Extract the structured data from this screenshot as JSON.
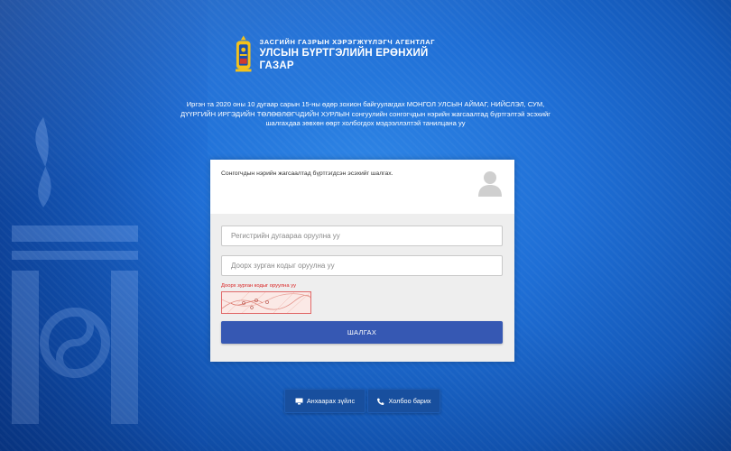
{
  "header": {
    "agency_line1": "ЗАСГИЙН ГАЗРЫН ХЭРЭГЖҮҮЛЭГЧ АГЕНТЛАГ",
    "agency_line2": "УЛСЫН БҮРТГЭЛИЙН ЕРӨНХИЙ ГАЗАР"
  },
  "intro_text": "Иргэн та 2020 оны 10 дугаар сарын 15-ны өдөр зохион байгуулагдах МОНГОЛ УЛСЫН АЙМАГ, НИЙСЛЭЛ, СУМ, ДҮҮРГИЙН ИРГЭДИЙН ТӨЛӨӨЛӨГЧДИЙН ХУРЛЫН сонгуулийн сонгогчдын нэрийн жагсаалтад бүртгэлтэй эсэхийг шалгахдаа зөвхөн өөрт холбогдох мэдээллэлтэй танилцана уу",
  "card": {
    "heading": "Сонгогчдын нэрийн жагсаалтад бүртгэгдсэн эсэхийг шалгах.",
    "register_placeholder": "Регистрийн дугаараа оруулна уу",
    "code_placeholder": "Доорх зурган кодыг оруулна уу",
    "captcha_label": "Доорх зурган кодыг оруулна уу",
    "submit_label": "ШАЛГАХ"
  },
  "footer": {
    "notice_label": "Анхаарах зүйлс",
    "contact_label": "Холбоо барих"
  },
  "colors": {
    "accent": "#3658b3",
    "background": "#1f6fd6",
    "error": "#d92020"
  }
}
